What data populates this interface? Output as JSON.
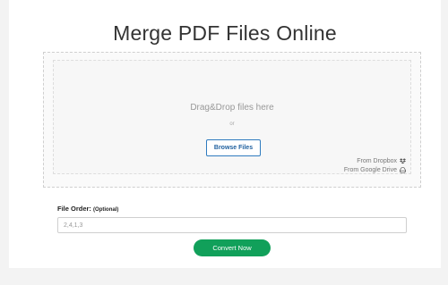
{
  "page": {
    "title": "Merge PDF Files Online"
  },
  "upload": {
    "drag_text": "Drag&Drop files here",
    "or_text": "or",
    "browse_label": "Browse Files",
    "dropbox_label": "From Dropbox",
    "gdrive_label": "From Google Drive",
    "dropbox_icon": "dropbox-icon",
    "gdrive_icon": "google-drive-icon"
  },
  "file_order": {
    "label": "File Order:",
    "optional": "(Optional)",
    "placeholder": "2,4,1,3",
    "value": ""
  },
  "actions": {
    "convert_label": "Convert Now",
    "convert_color": "#11a05a",
    "browse_border_color": "#2f7bbf"
  }
}
